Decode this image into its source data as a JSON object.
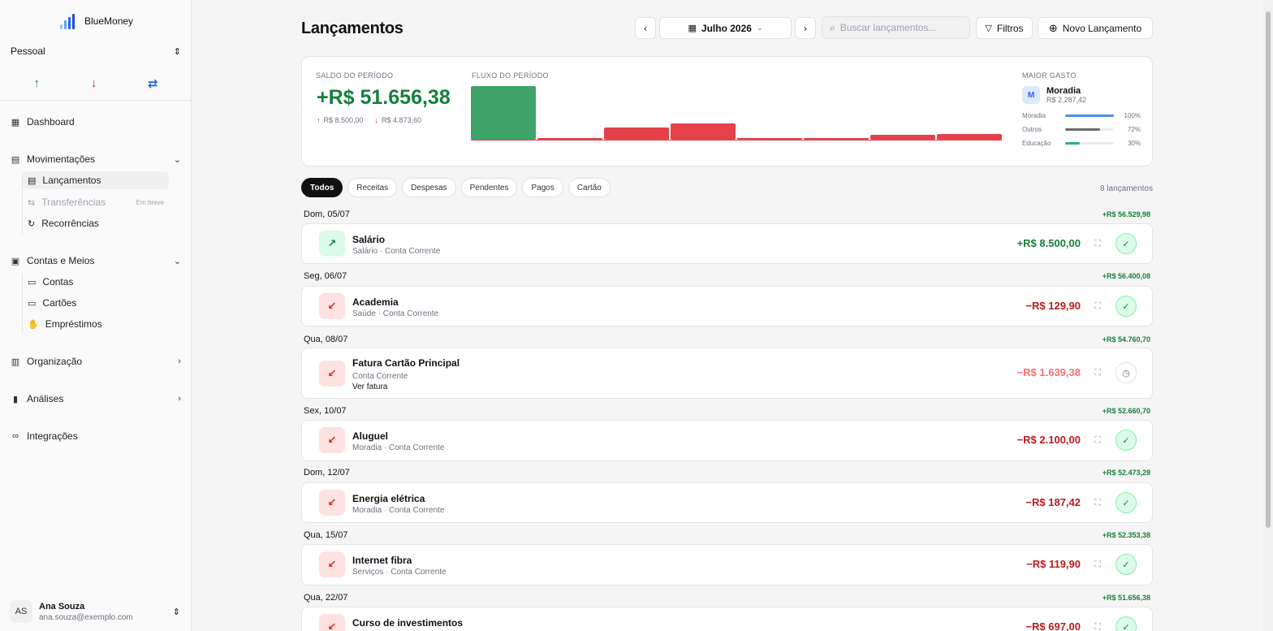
{
  "app": {
    "name": "BlueMoney"
  },
  "sidebar": {
    "workspace": "Pessoal",
    "quick_actions": [
      {
        "icon": "arrow-up-icon",
        "glyph": "↑",
        "color": "#15803d"
      },
      {
        "icon": "arrow-down-icon",
        "glyph": "↓",
        "color": "#dc2626"
      },
      {
        "icon": "transfer-icon",
        "glyph": "⇄",
        "color": "#2563eb"
      }
    ],
    "dashboard": "Dashboard",
    "movimentacoes": {
      "label": "Movimentações",
      "items": [
        {
          "label": "Lançamentos",
          "active": true
        },
        {
          "label": "Transferências",
          "badge": "Em breve",
          "disabled": true
        },
        {
          "label": "Recorrências"
        }
      ]
    },
    "contas": {
      "label": "Contas e Meios",
      "items": [
        {
          "label": "Contas"
        },
        {
          "label": "Cartões"
        },
        {
          "label": "Empréstimos"
        }
      ]
    },
    "organizacao": "Organização",
    "analises": "Análises",
    "integracoes": "Integrações",
    "user": {
      "initials": "AS",
      "name": "Ana Souza",
      "email": "ana.souza@exemplo.com"
    }
  },
  "header": {
    "title": "Lançamentos",
    "period": "Julho 2026",
    "search_placeholder": "Buscar lançamentos...",
    "filters": "Filtros",
    "new_entry": "Novo Lançamento"
  },
  "summary": {
    "balance_label": "SALDO DO PERÍODO",
    "balance": "+R$ 51.656,38",
    "income": "R$ 8.500,00",
    "expense": "R$ 4.873,60",
    "flow_label": "FLUXO DO PERÍODO",
    "flow": {
      "max": 8500,
      "bars": [
        {
          "value": 8500,
          "type": "in"
        },
        {
          "value": 129.9,
          "type": "out"
        },
        {
          "value": 1639.38,
          "type": "out"
        },
        {
          "value": 2100,
          "type": "out"
        },
        {
          "value": 187.42,
          "type": "out"
        },
        {
          "value": 119.9,
          "type": "out"
        },
        {
          "value": 697,
          "type": "out"
        },
        {
          "value": 700,
          "type": "out"
        }
      ],
      "colors": {
        "in": "#3fa467",
        "out": "#e5414a"
      }
    },
    "top_label": "MAIOR GASTO",
    "top": {
      "initial": "M",
      "name": "Moradia",
      "amount": "R$ 2.287,42"
    },
    "categories": [
      {
        "name": "Moradia",
        "pct": "100%",
        "value": 1.0,
        "color": "#4a8fe7"
      },
      {
        "name": "Outros",
        "pct": "72%",
        "value": 0.72,
        "color": "#6b6b6b"
      },
      {
        "name": "Educação",
        "pct": "30%",
        "value": 0.3,
        "color": "#2fb36f"
      }
    ]
  },
  "tabs": [
    "Todos",
    "Receitas",
    "Despesas",
    "Pendentes",
    "Pagos",
    "Cartão"
  ],
  "count": "8 lançamentos",
  "groups": [
    {
      "date": "Dom, 05/07",
      "running": "+R$ 56.529,98",
      "tx": {
        "title": "Salário",
        "sub": "Salário · Conta Corrente",
        "amount": "+R$ 8.500,00",
        "type": "in",
        "status": "done"
      }
    },
    {
      "date": "Seg, 06/07",
      "running": "+R$ 56.400,08",
      "tx": {
        "title": "Academia",
        "sub": "Saúde · Conta Corrente",
        "amount": "−R$ 129,90",
        "type": "out",
        "status": "done"
      }
    },
    {
      "date": "Qua, 08/07",
      "running": "+R$ 54.760,70",
      "tx": {
        "title": "Fatura Cartão Principal",
        "sub": "Conta Corrente",
        "link": "Ver fatura",
        "amount": "−R$ 1.639,38",
        "type": "pend",
        "status": "pending"
      }
    },
    {
      "date": "Sex, 10/07",
      "running": "+R$ 52.660,70",
      "tx": {
        "title": "Aluguel",
        "sub": "Moradia · Conta Corrente",
        "amount": "−R$ 2.100,00",
        "type": "out",
        "status": "done"
      }
    },
    {
      "date": "Dom, 12/07",
      "running": "+R$ 52.473,28",
      "tx": {
        "title": "Energia elétrica",
        "sub": "Moradia · Conta Corrente",
        "amount": "−R$ 187,42",
        "type": "out",
        "status": "done"
      }
    },
    {
      "date": "Qua, 15/07",
      "running": "+R$ 52.353,38",
      "tx": {
        "title": "Internet fibra",
        "sub": "Serviços · Conta Corrente",
        "amount": "−R$ 119,90",
        "type": "out",
        "status": "done"
      }
    },
    {
      "date": "Qua, 22/07",
      "running": "+R$ 51.656,38",
      "tx": {
        "title": "Curso de investimentos",
        "sub": "",
        "amount": "−R$ 697,00",
        "type": "out",
        "status": "done"
      }
    }
  ]
}
